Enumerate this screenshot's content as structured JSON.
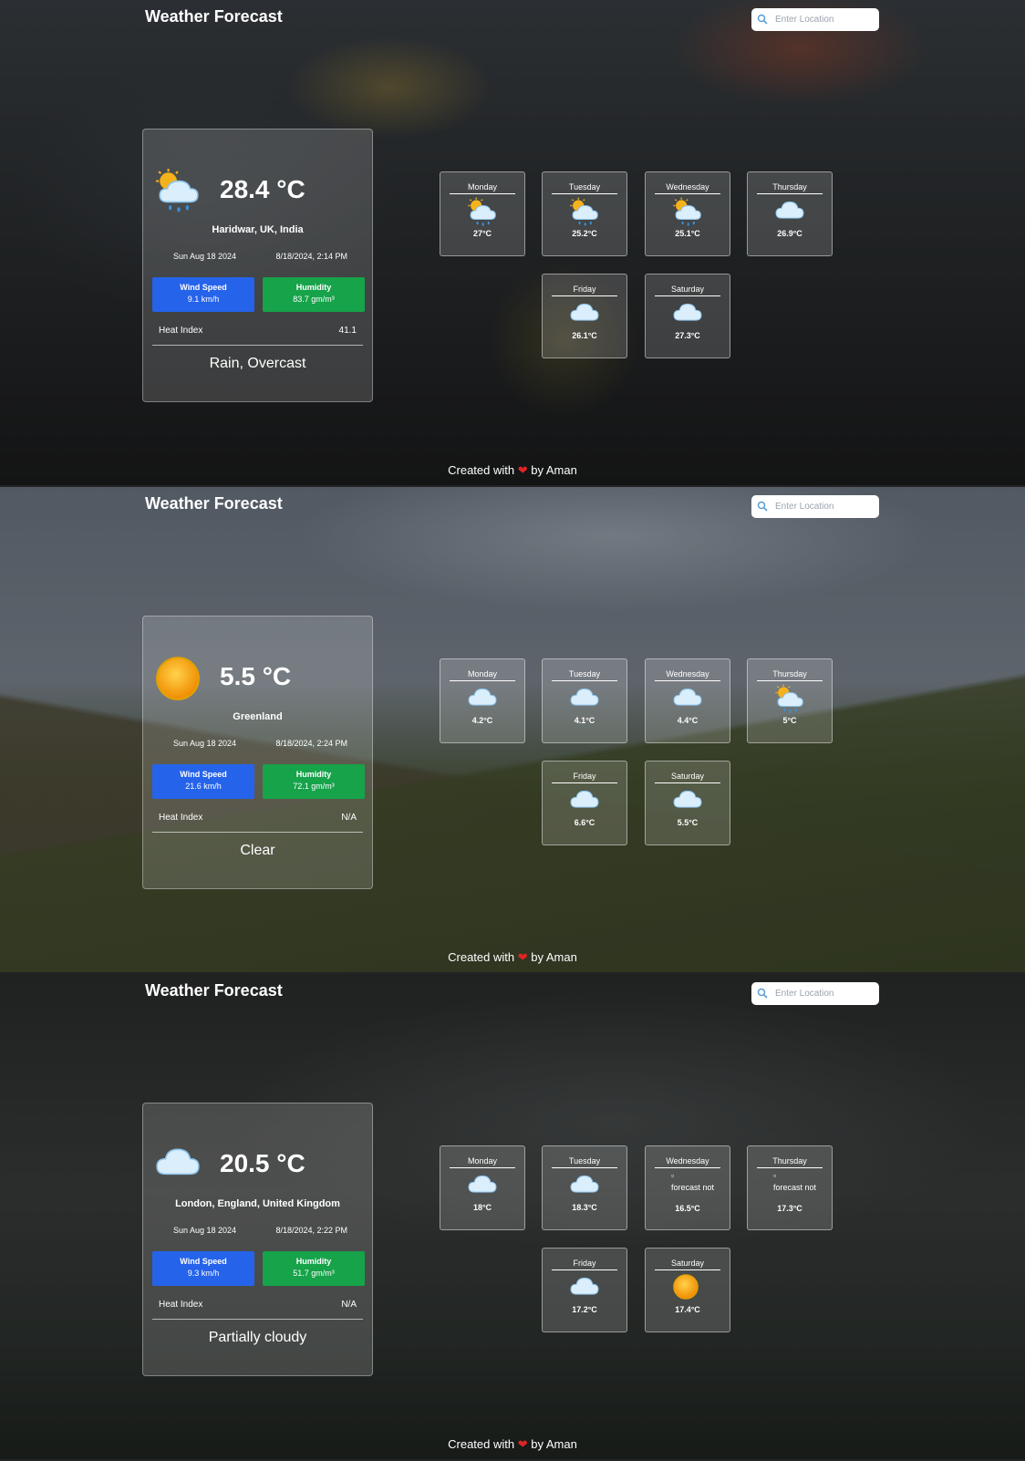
{
  "panels": [
    {
      "app_title": "Weather Forecast",
      "search_placeholder": "Enter Location",
      "current": {
        "icon": "sun-cloud-rain-icon",
        "temperature": "28.4 °C",
        "location": "Haridwar, UK, India",
        "date": "Sun Aug 18 2024",
        "datetime": "8/18/2024, 2:14 PM",
        "wind_label": "Wind Speed",
        "wind_value": "9.1 km/h",
        "humidity_label": "Humidity",
        "humidity_value": "83.7 gm/m³",
        "heat_label": "Heat Index",
        "heat_value": "41.1",
        "condition": "Rain, Overcast"
      },
      "forecast": [
        {
          "day": "Monday",
          "temp": "27°C",
          "icon": "sun-cloud-rain-icon"
        },
        {
          "day": "Tuesday",
          "temp": "25.2°C",
          "icon": "sun-cloud-rain-icon"
        },
        {
          "day": "Wednesday",
          "temp": "25.1°C",
          "icon": "sun-cloud-rain-icon"
        },
        {
          "day": "Thursday",
          "temp": "26.9°C",
          "icon": "cloud-icon"
        },
        {
          "day": "Friday",
          "temp": "26.1°C",
          "icon": "cloud-icon"
        },
        {
          "day": "Saturday",
          "temp": "27.3°C",
          "icon": "cloud-icon"
        }
      ],
      "footer": {
        "before": "Created with",
        "heart": "❤",
        "after": "by Aman"
      }
    },
    {
      "app_title": "Weather Forecast",
      "search_placeholder": "Enter Location",
      "current": {
        "icon": "sun-icon",
        "temperature": "5.5 °C",
        "location": "Greenland",
        "date": "Sun Aug 18 2024",
        "datetime": "8/18/2024, 2:24 PM",
        "wind_label": "Wind Speed",
        "wind_value": "21.6 km/h",
        "humidity_label": "Humidity",
        "humidity_value": "72.1 gm/m³",
        "heat_label": "Heat Index",
        "heat_value": "N/A",
        "condition": "Clear"
      },
      "forecast": [
        {
          "day": "Monday",
          "temp": "4.2°C",
          "icon": "cloud-icon"
        },
        {
          "day": "Tuesday",
          "temp": "4.1°C",
          "icon": "cloud-icon"
        },
        {
          "day": "Wednesday",
          "temp": "4.4°C",
          "icon": "cloud-icon"
        },
        {
          "day": "Thursday",
          "temp": "5°C",
          "icon": "sun-cloud-rain-icon"
        },
        {
          "day": "Friday",
          "temp": "6.6°C",
          "icon": "cloud-icon"
        },
        {
          "day": "Saturday",
          "temp": "5.5°C",
          "icon": "cloud-icon"
        }
      ],
      "footer": {
        "before": "Created with",
        "heart": "❤",
        "after": "by Aman"
      }
    },
    {
      "app_title": "Weather Forecast",
      "search_placeholder": "Enter Location",
      "current": {
        "icon": "cloud-icon",
        "temperature": "20.5 °C",
        "location": "London, England, United Kingdom",
        "date": "Sun Aug 18 2024",
        "datetime": "8/18/2024, 2:22 PM",
        "wind_label": "Wind Speed",
        "wind_value": "9.3 km/h",
        "humidity_label": "Humidity",
        "humidity_value": "51.7 gm/m³",
        "heat_label": "Heat Index",
        "heat_value": "N/A",
        "condition": "Partially cloudy"
      },
      "forecast": [
        {
          "day": "Monday",
          "temp": "18°C",
          "icon": "cloud-icon"
        },
        {
          "day": "Tuesday",
          "temp": "18.3°C",
          "icon": "cloud-icon"
        },
        {
          "day": "Wednesday",
          "temp": "16.5°C",
          "icon": "broken-image-icon",
          "alt_text": "forecast not"
        },
        {
          "day": "Thursday",
          "temp": "17.3°C",
          "icon": "broken-image-icon",
          "alt_text": "forecast not"
        },
        {
          "day": "Friday",
          "temp": "17.2°C",
          "icon": "cloud-icon"
        },
        {
          "day": "Saturday",
          "temp": "17.4°C",
          "icon": "sun-icon"
        }
      ],
      "footer": {
        "before": "Created with",
        "heart": "❤",
        "after": "by Aman"
      }
    }
  ]
}
